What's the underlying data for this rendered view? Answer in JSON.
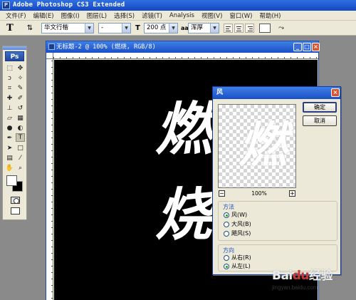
{
  "app": {
    "title": "Adobe Photoshop CS3 Extended",
    "icon": "ps-mini-icon"
  },
  "menu": [
    "文件(F)",
    "编辑(E)",
    "图像(I)",
    "图层(L)",
    "选择(S)",
    "滤镜(T)",
    "Analysis",
    "视图(V)",
    "窗口(W)",
    "帮助(H)"
  ],
  "options": {
    "tool_label": "T",
    "font_family": "华文行楷",
    "font_style": "-",
    "font_size": "200 点",
    "aa_icon": "aa",
    "aa_mode": "浑厚"
  },
  "toolbox": {
    "logo": "Ps"
  },
  "document": {
    "title": "无标题-2 @ 100% (燃烧, RGB/8)",
    "text_line1": "燃",
    "text_line2": "烧",
    "canvas_color": "#000000"
  },
  "dialog": {
    "title": "风",
    "ok_label": "确定",
    "cancel_label": "取消",
    "zoom": "100%",
    "preview_glyph": "燃",
    "method": {
      "legend": "方法",
      "options": [
        "风(W)",
        "大风(B)",
        "飓风(S)"
      ],
      "selected": 0
    },
    "direction": {
      "legend": "方向",
      "options": [
        "从右(R)",
        "从左(L)"
      ],
      "selected": 1
    }
  },
  "watermark": {
    "logo": "Bai",
    "paw": "du",
    "suffix": "经验",
    "url": "jingyan.baidu.com"
  },
  "colors": {
    "titlebar": "#1a4fc7",
    "panel": "#ece9d8",
    "close": "#d8532f",
    "foreground": "#ffffff",
    "background": "#000000"
  }
}
